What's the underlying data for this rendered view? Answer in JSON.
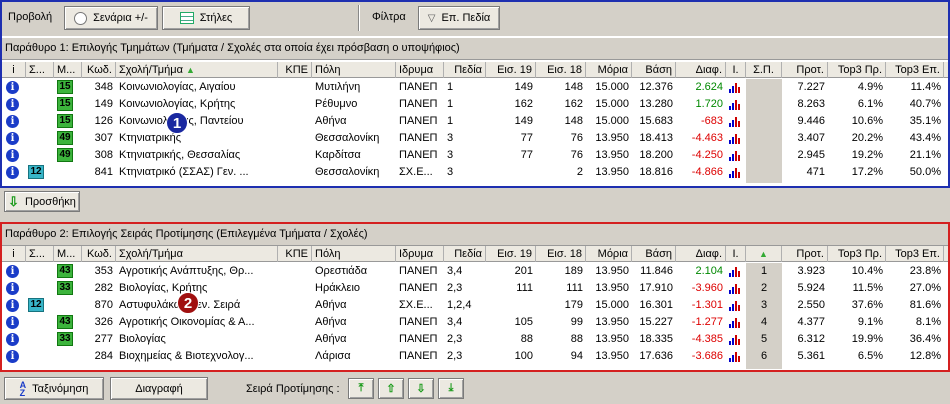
{
  "toolbar": {
    "view_label": "Προβολή",
    "scenarios_label": "Σενάρια +/-",
    "columns_label": "Στήλες",
    "filters_label": "Φίλτρα",
    "fields_label": "Επ. Πεδία"
  },
  "columns": [
    "i",
    "Σ...",
    "Μ...",
    "Κωδ.",
    "Σχολή/Τμήμα",
    "ΚΠΕ",
    "Πόλη",
    "Ιδρυμα",
    "Πεδία",
    "Εισ. 19",
    "Εισ. 18",
    "Μόρια",
    "Βάση",
    "Διαφ.",
    "Ι.",
    "Σ.Π.",
    "Προτ.",
    "Top3 Πρ.",
    "Top3 Επ."
  ],
  "window1": {
    "caption": "Παράθυρο 1: Επιλογής Τμημάτων (Τμήματα / Σχολές στα οποία έχει πρόσβαση ο υποψήφιος)",
    "rows": [
      {
        "group": "15",
        "code": "348",
        "dept": "Κοινωνιολογίας, Αιγαίου",
        "city": "Μυτιλήνη",
        "inst": "ΠΑΝΕΠ",
        "fields": "1",
        "e19": "149",
        "e18": "148",
        "points": "15.000",
        "base": "12.376",
        "diff": "2.624",
        "sign": "pos",
        "sp": "",
        "prot": "7.227",
        "t3p": "4.9%",
        "t3e": "11.4%"
      },
      {
        "group": "15",
        "code": "149",
        "dept": "Κοινωνιολογίας, Κρήτης",
        "city": "Ρέθυμνο",
        "inst": "ΠΑΝΕΠ",
        "fields": "1",
        "e19": "162",
        "e18": "162",
        "points": "15.000",
        "base": "13.280",
        "diff": "1.720",
        "sign": "pos",
        "sp": "",
        "prot": "8.263",
        "t3p": "6.1%",
        "t3e": "40.7%"
      },
      {
        "group": "15",
        "code": "126",
        "dept": "Κοινωνιολογίας, Παντείου",
        "city": "Αθήνα",
        "inst": "ΠΑΝΕΠ",
        "fields": "1",
        "e19": "149",
        "e18": "148",
        "points": "15.000",
        "base": "15.683",
        "diff": "-683",
        "sign": "neg",
        "sp": "",
        "prot": "9.446",
        "t3p": "10.6%",
        "t3e": "35.1%"
      },
      {
        "group": "49",
        "code": "307",
        "dept": "Κτηνιατρικής",
        "city": "Θεσσαλονίκη",
        "inst": "ΠΑΝΕΠ",
        "fields": "3",
        "e19": "77",
        "e18": "76",
        "points": "13.950",
        "base": "18.413",
        "diff": "-4.463",
        "sign": "neg",
        "sp": "",
        "prot": "3.407",
        "t3p": "20.2%",
        "t3e": "43.4%"
      },
      {
        "group": "49",
        "code": "308",
        "dept": "Κτηνιατρικής, Θεσσαλίας",
        "city": "Καρδίτσα",
        "inst": "ΠΑΝΕΠ",
        "fields": "3",
        "e19": "77",
        "e18": "76",
        "points": "13.950",
        "base": "18.200",
        "diff": "-4.250",
        "sign": "neg",
        "sp": "",
        "prot": "2.945",
        "t3p": "19.2%",
        "t3e": "21.1%"
      },
      {
        "group": "12",
        "alt": true,
        "code": "841",
        "dept": "Κτηνιατρικό (ΣΣΑΣ) Γεν. ...",
        "city": "Θεσσαλονίκη",
        "inst": "ΣΧ.Ε...",
        "fields": "3",
        "e19": "",
        "e18": "2",
        "points": "13.950",
        "base": "18.816",
        "diff": "-4.866",
        "sign": "neg",
        "sp": "",
        "prot": "471",
        "t3p": "17.2%",
        "t3e": "50.0%"
      }
    ]
  },
  "add_button": "Προσθήκη",
  "window2": {
    "caption": "Παράθυρο 2: Επιλογής Σειράς Προτίμησης (Επιλεγμένα Τμήματα / Σχολές)",
    "rows": [
      {
        "group": "43",
        "code": "353",
        "dept": "Αγροτικής Ανάπτυξης, Θρ...",
        "city": "Ορεστιάδα",
        "inst": "ΠΑΝΕΠ",
        "fields": "3,4",
        "e19": "201",
        "e18": "189",
        "points": "13.950",
        "base": "11.846",
        "diff": "2.104",
        "sign": "pos",
        "sp": "1",
        "prot": "3.923",
        "t3p": "10.4%",
        "t3e": "23.8%"
      },
      {
        "group": "33",
        "code": "282",
        "dept": "Βιολογίας, Κρήτης",
        "city": "Ηράκλειο",
        "inst": "ΠΑΝΕΠ",
        "fields": "2,3",
        "e19": "111",
        "e18": "111",
        "points": "13.950",
        "base": "17.910",
        "diff": "-3.960",
        "sign": "neg",
        "sp": "2",
        "prot": "5.924",
        "t3p": "11.5%",
        "t3e": "27.0%"
      },
      {
        "group": "12",
        "alt": true,
        "code": "870",
        "dept": "Αστυφυλάκων Γεν. Σειρά",
        "city": "Αθήνα",
        "inst": "ΣΧ.Ε...",
        "fields": "1,2,4",
        "e19": "",
        "e18": "179",
        "points": "15.000",
        "base": "16.301",
        "diff": "-1.301",
        "sign": "neg",
        "sp": "3",
        "prot": "2.550",
        "t3p": "37.6%",
        "t3e": "81.6%"
      },
      {
        "group": "43",
        "code": "326",
        "dept": "Αγροτικής Οικονομίας & Α...",
        "city": "Αθήνα",
        "inst": "ΠΑΝΕΠ",
        "fields": "3,4",
        "e19": "105",
        "e18": "99",
        "points": "13.950",
        "base": "15.227",
        "diff": "-1.277",
        "sign": "neg",
        "sp": "4",
        "prot": "4.377",
        "t3p": "9.1%",
        "t3e": "8.1%"
      },
      {
        "group": "33",
        "code": "277",
        "dept": "Βιολογίας",
        "city": "Αθήνα",
        "inst": "ΠΑΝΕΠ",
        "fields": "2,3",
        "e19": "88",
        "e18": "88",
        "points": "13.950",
        "base": "18.335",
        "diff": "-4.385",
        "sign": "neg",
        "sp": "5",
        "prot": "6.312",
        "t3p": "19.9%",
        "t3e": "36.4%"
      },
      {
        "group": "",
        "code": "284",
        "dept": "Βιοχημείας & Βιοτεχνολογ...",
        "city": "Λάρισα",
        "inst": "ΠΑΝΕΠ",
        "fields": "2,3",
        "e19": "100",
        "e18": "94",
        "points": "13.950",
        "base": "17.636",
        "diff": "-3.686",
        "sign": "neg",
        "sp": "6",
        "prot": "5.361",
        "t3p": "6.5%",
        "t3e": "12.8%"
      }
    ]
  },
  "bottom": {
    "sort_label": "Ταξινόμηση",
    "delete_label": "Διαγραφή",
    "order_label": "Σειρά Προτίμησης :"
  },
  "markers": {
    "one": "1",
    "two": "2"
  },
  "colors": {
    "frame1": "#1e2fb0",
    "frame2": "#d42020",
    "positive": "#008800",
    "negative": "#dd0000"
  }
}
